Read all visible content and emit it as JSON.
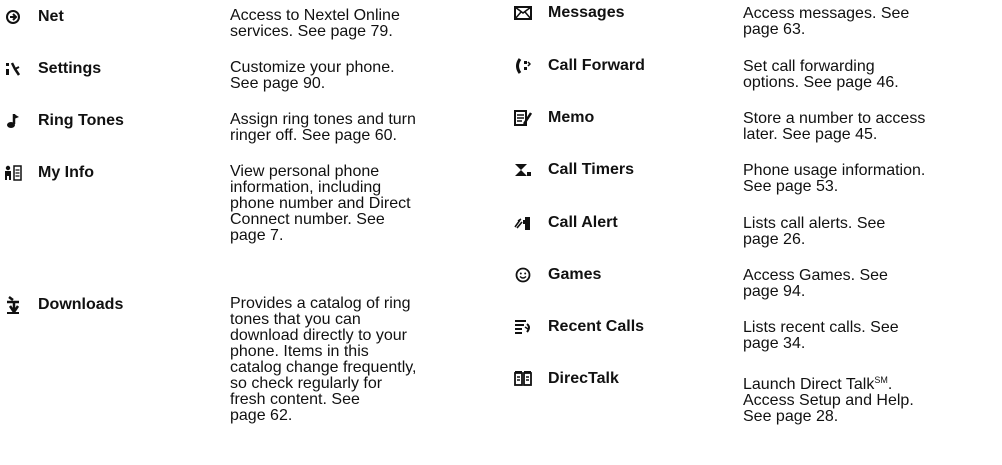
{
  "left": [
    {
      "icon": "net-icon",
      "name": "Net",
      "desc": "Access to Nextel Online\nservices. See page 79."
    },
    {
      "icon": "settings-icon",
      "name": "Settings",
      "desc": "Customize your phone.\nSee page 90."
    },
    {
      "icon": "ring-tones-icon",
      "name": "Ring Tones",
      "desc": "Assign ring tones and turn\nringer off. See page 60."
    },
    {
      "icon": "my-info-icon",
      "name": "My Info",
      "desc": "View personal phone\ninformation, including\nphone number and Direct\nConnect number. See\npage 7."
    },
    {
      "icon": "downloads-icon",
      "name": "Downloads",
      "desc": "Provides a catalog of ring\ntones that you can\ndownload directly to your\nphone. Items in this\ncatalog change frequently,\nso check regularly for\nfresh content. See\npage 62."
    }
  ],
  "right": [
    {
      "icon": "messages-icon",
      "name": "Messages",
      "desc": "Access messages. See\npage 63."
    },
    {
      "icon": "call-forward-icon",
      "name": "Call Forward",
      "desc": "Set call forwarding\noptions. See page 46."
    },
    {
      "icon": "memo-icon",
      "name": "Memo",
      "desc": "Store a number to access\nlater. See page 45."
    },
    {
      "icon": "call-timers-icon",
      "name": "Call Timers",
      "desc": "Phone usage information.\nSee page 53."
    },
    {
      "icon": "call-alert-icon",
      "name": "Call Alert",
      "desc": "Lists call alerts. See\npage 26."
    },
    {
      "icon": "games-icon",
      "name": "Games",
      "desc": "Access Games. See\npage 94."
    },
    {
      "icon": "recent-calls-icon",
      "name": "Recent Calls",
      "desc": "Lists recent calls. See\npage 34."
    },
    {
      "icon": "directalk-icon",
      "name": "DirecTalk",
      "desc_pre": "Launch Direct Talk",
      "desc_sup": "SM",
      "desc_post": ".\nAccess  Setup and Help.\nSee page 28."
    }
  ]
}
